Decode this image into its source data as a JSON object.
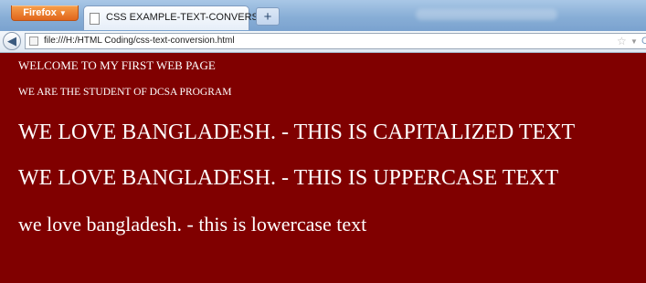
{
  "browser": {
    "app_button_label": "Firefox",
    "tab_title": "CSS EXAMPLE-TEXT-CONVERSION",
    "new_tab_label": "+",
    "url": "file:///H:/HTML Coding/css-text-conversion.html",
    "colors": {
      "app_button": "#e8761f",
      "titlebar": "#88aed6"
    }
  },
  "page": {
    "background_color": "#800000",
    "text_color": "#ffffff",
    "lines": {
      "welcome": "WELCOME TO MY FIRST WEB PAGE",
      "student": "WE ARE THE STUDENT OF DCSA PROGRAM",
      "capitalized": "WE LOVE BANGLADESH. - THIS IS CAPITALIZED TEXT",
      "uppercase": "WE LOVE BANGLADESH. - THIS IS UPPERCASE TEXT",
      "lowercase": "we love bangladesh. - this is lowercase text"
    }
  },
  "icons": {
    "back": "back-arrow-icon",
    "site": "page-icon",
    "bookmark": "star-icon",
    "dropdown": "chevron-down-icon"
  }
}
